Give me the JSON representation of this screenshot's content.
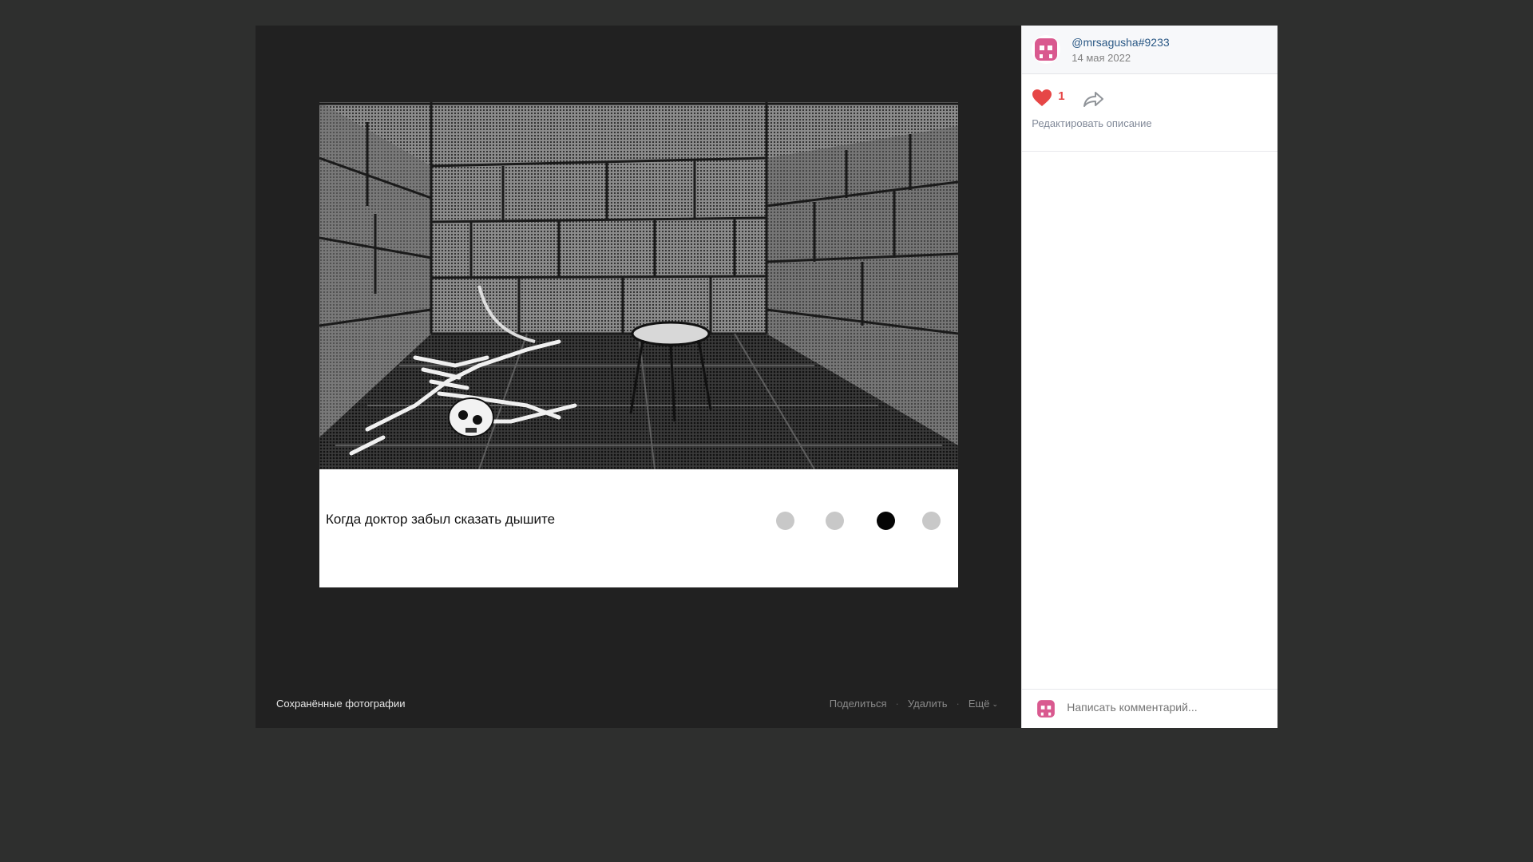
{
  "post": {
    "username": "@mrsagusha#9233",
    "date": "14 мая 2022",
    "likes": "1",
    "edit_description": "Редактировать описание"
  },
  "meme": {
    "caption": "Когда доктор забыл сказать дышите",
    "dots_total": 4,
    "active_dot_index": 2
  },
  "footer": {
    "album": "Сохранённые фотографии",
    "share": "Поделиться",
    "delete": "Удалить",
    "more": "Ещё",
    "separator": "·"
  },
  "comment": {
    "placeholder": "Написать комментарий..."
  },
  "icons": {
    "avatar": "pink-pixel-skull-icon",
    "like": "heart-icon",
    "share": "share-arrow-icon",
    "more": "chevron-down-icon"
  },
  "colors": {
    "like_red": "#e64646",
    "link_blue": "#2a5885",
    "avatar_pink": "#d9598f"
  }
}
